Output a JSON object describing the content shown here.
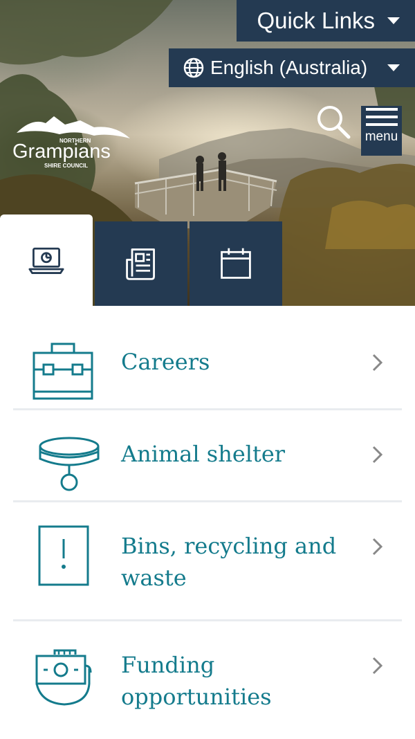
{
  "header": {
    "quick_links_label": "Quick Links",
    "language_label": "English (Australia)",
    "menu_label": "menu",
    "logo": {
      "line1": "NORTHERN",
      "line2": "Grampians",
      "line3": "SHIRE COUNCIL"
    }
  },
  "tabs": [
    {
      "icon": "laptop-icon",
      "active": true
    },
    {
      "icon": "newspaper-icon",
      "active": false
    },
    {
      "icon": "calendar-icon",
      "active": false
    }
  ],
  "list": [
    {
      "label": "Careers",
      "icon": "briefcase-icon"
    },
    {
      "label": "Animal shelter",
      "icon": "pet-collar-icon"
    },
    {
      "label": "Bins, recycling and waste",
      "icon": "bin-icon"
    },
    {
      "label": "Funding opportunities",
      "icon": "hand-money-icon"
    }
  ],
  "colors": {
    "navy": "#243a52",
    "teal": "#147b8c",
    "divider": "#e9ecef"
  }
}
